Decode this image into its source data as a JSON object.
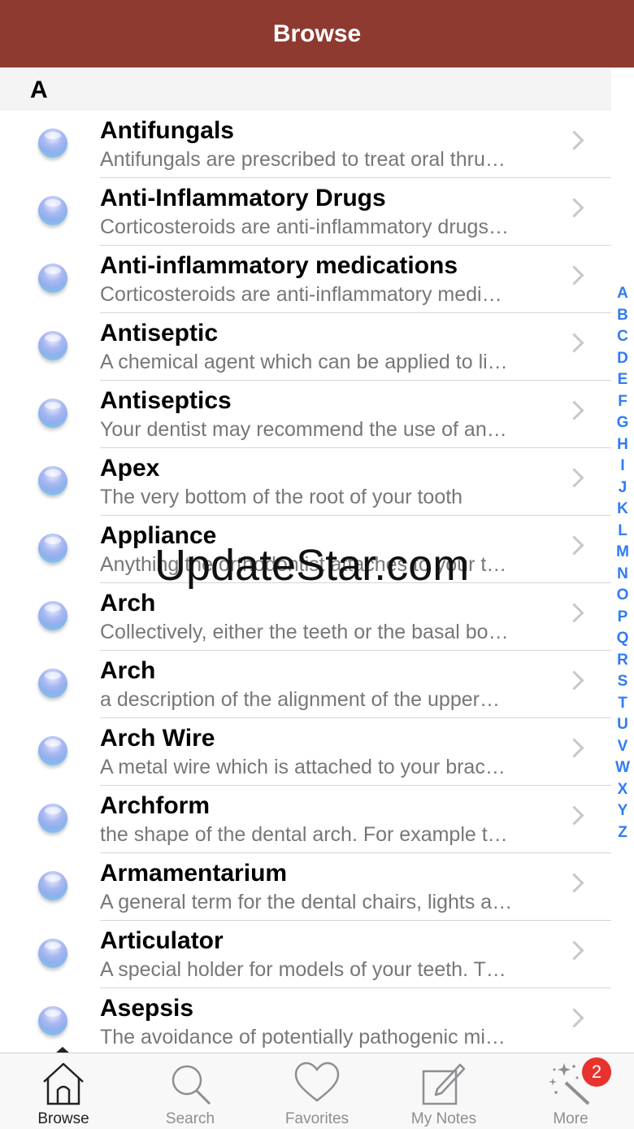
{
  "navbar": {
    "title": "Browse"
  },
  "section": {
    "letter": "A"
  },
  "rows": [
    {
      "term": "Antifungals",
      "desc": "Antifungals are prescribed to treat oral thru…"
    },
    {
      "term": "Anti-Inflammatory Drugs",
      "desc": "Corticosteroids are anti-inflammatory drugs…"
    },
    {
      "term": "Anti-inflammatory medications",
      "desc": "Corticosteroids are anti-inflammatory medi…"
    },
    {
      "term": "Antiseptic",
      "desc": "A chemical agent which can be applied to li…"
    },
    {
      "term": "Antiseptics",
      "desc": "Your dentist may recommend the use of an…"
    },
    {
      "term": "Apex",
      "desc": "The very bottom of the root of your tooth"
    },
    {
      "term": "Appliance",
      "desc": "Anything the orthodontist attaches to your t…"
    },
    {
      "term": "Arch",
      "desc": "Collectively, either the teeth or the basal bo…"
    },
    {
      "term": "Arch",
      "desc": "a description of the alignment of the upper…"
    },
    {
      "term": "Arch Wire",
      "desc": "A metal wire which is attached to your brac…"
    },
    {
      "term": "Archform",
      "desc": "the shape of the dental arch. For example t…"
    },
    {
      "term": "Armamentarium",
      "desc": "A general term for the dental chairs, lights a…"
    },
    {
      "term": "Articulator",
      "desc": "A special holder for models of your teeth. T…"
    },
    {
      "term": "Asepsis",
      "desc": "The avoidance of potentially pathogenic mi…"
    }
  ],
  "index_letters": [
    "A",
    "B",
    "C",
    "D",
    "E",
    "F",
    "G",
    "H",
    "I",
    "J",
    "K",
    "L",
    "M",
    "N",
    "O",
    "P",
    "Q",
    "R",
    "S",
    "T",
    "U",
    "V",
    "W",
    "X",
    "Y",
    "Z"
  ],
  "watermark": "UpdateStar.com",
  "tabs": [
    {
      "label": "Browse",
      "icon": "home-icon",
      "active": true
    },
    {
      "label": "Search",
      "icon": "search-icon",
      "active": false
    },
    {
      "label": "Favorites",
      "icon": "heart-icon",
      "active": false
    },
    {
      "label": "My Notes",
      "icon": "notes-icon",
      "active": false
    },
    {
      "label": "More",
      "icon": "magic-wand-icon",
      "active": false
    }
  ],
  "more_badge": "2",
  "colors": {
    "navbar": "#8e3a31",
    "index": "#2f7cf6",
    "badge": "#e8322d",
    "tab_inactive": "#8e8e93"
  }
}
